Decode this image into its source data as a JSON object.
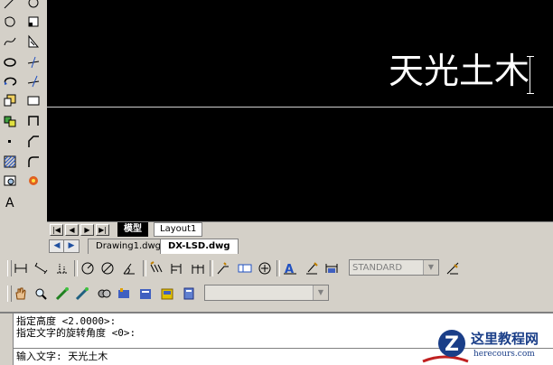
{
  "canvas": {
    "text": "天光土木"
  },
  "layout_tabs": {
    "nav": [
      "|◀",
      "◀",
      "▶",
      "▶|"
    ],
    "model": "模型",
    "layout1": "Layout1"
  },
  "doc_tabs": {
    "nav_prev": "◀",
    "nav_next": "▶",
    "tabs": [
      "Drawing1.dwg",
      "DX-LSD.dwg"
    ]
  },
  "toolbar2": {
    "text_style": "STANDARD"
  },
  "command": {
    "line1": "指定高度 <2.0000>:",
    "line2": "指定文字的旋转角度 <0>:",
    "line3": "输入文字: 天光土木"
  },
  "watermark": {
    "title": "这里教程网",
    "url": "herecours.com",
    "logo_letter": "Z"
  }
}
